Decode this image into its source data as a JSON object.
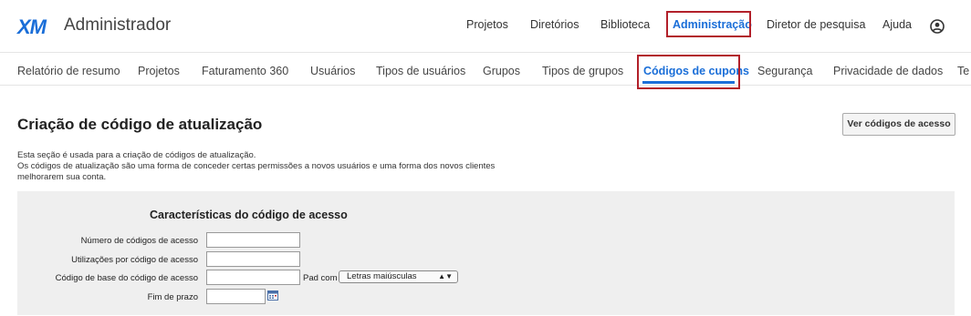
{
  "app": {
    "logo": "XM",
    "title": "Administrador"
  },
  "topnav": {
    "items": [
      "Projetos",
      "Diretórios",
      "Biblioteca",
      "Administração",
      "Diretor de pesquisa",
      "Ajuda"
    ],
    "active": "Administração",
    "profile_icon": "user-circle-icon"
  },
  "subnav": {
    "tabs": [
      "Relatório de resumo",
      "Projetos",
      "Faturamento 360",
      "Usuários",
      "Tipos de usuários",
      "Grupos",
      "Tipos de grupos",
      "Códigos de cupons",
      "Segurança",
      "Privacidade de dados",
      "Te"
    ],
    "active": "Códigos de cupons"
  },
  "page": {
    "title": "Criação de código de atualização",
    "view_button": "Ver códigos de acesso",
    "description": [
      "Esta seção é usada para a criação de códigos de atualização.",
      "Os códigos de atualização são uma forma de conceder certas permissões a novos usuários e uma forma dos novos clientes",
      "melhorarem sua conta."
    ]
  },
  "form": {
    "title": "Características do código de acesso",
    "fields": [
      {
        "label": "Número de códigos de acesso",
        "value": ""
      },
      {
        "label": "Utilizações por código de acesso",
        "value": ""
      },
      {
        "label": "Código de base do código de acesso",
        "value": ""
      },
      {
        "label": "Fim de prazo",
        "value": ""
      }
    ],
    "pad_label": "Pad com",
    "pad_select": "Letras maiúsculas",
    "calendar_icon": "calendar-icon"
  },
  "colors": {
    "accent": "#1a6ed8",
    "highlight": "#b2202a",
    "panel": "#efefef"
  }
}
